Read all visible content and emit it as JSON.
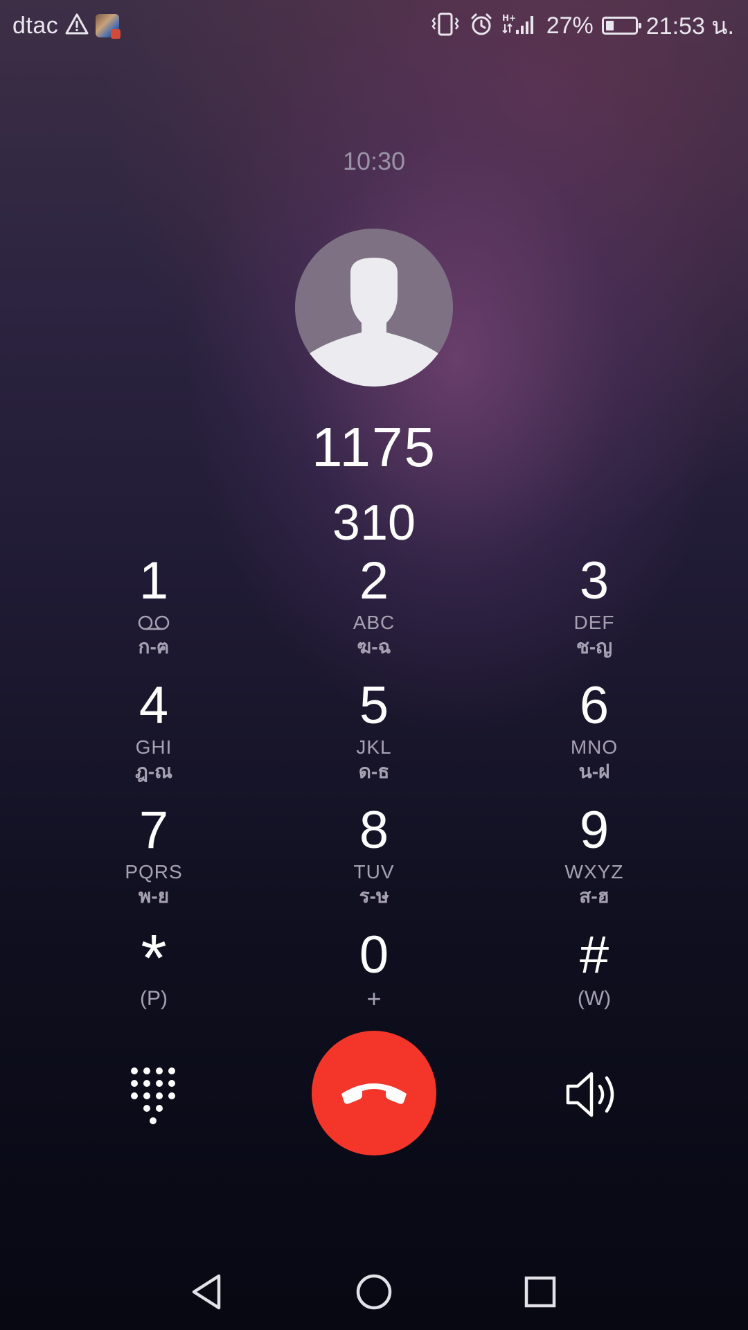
{
  "status_bar": {
    "carrier": "dtac",
    "battery_percent": "27%",
    "battery_level": 0.27,
    "time": "21:53 น.",
    "icons": [
      "warning-icon",
      "app-notification-icon",
      "vibrate-icon",
      "alarm-icon",
      "hplus-icon",
      "signal-icon",
      "battery-icon"
    ]
  },
  "call": {
    "duration": "10:30",
    "number": "1175",
    "dtmf_digits": "310"
  },
  "keypad": {
    "keys": [
      {
        "digit": "1",
        "letters": "",
        "thai": "ก-ฅ",
        "icon": "voicemail-icon"
      },
      {
        "digit": "2",
        "letters": "ABC",
        "thai": "ฆ-ฉ"
      },
      {
        "digit": "3",
        "letters": "DEF",
        "thai": "ช-ญ"
      },
      {
        "digit": "4",
        "letters": "GHI",
        "thai": "ฎ-ณ"
      },
      {
        "digit": "5",
        "letters": "JKL",
        "thai": "ด-ธ"
      },
      {
        "digit": "6",
        "letters": "MNO",
        "thai": "น-ฝ"
      },
      {
        "digit": "7",
        "letters": "PQRS",
        "thai": "พ-ย"
      },
      {
        "digit": "8",
        "letters": "TUV",
        "thai": "ร-ษ"
      },
      {
        "digit": "9",
        "letters": "WXYZ",
        "thai": "ส-ฮ"
      },
      {
        "digit": "*",
        "sub": "(P)"
      },
      {
        "digit": "0",
        "sub": "+"
      },
      {
        "digit": "#",
        "sub": "(W)"
      }
    ]
  },
  "controls": {
    "end_call_color": "#f4362a",
    "icons": [
      "dialpad-icon",
      "end-call-icon",
      "speaker-icon"
    ]
  },
  "nav": {
    "icons": [
      "back-icon",
      "home-icon",
      "recents-icon"
    ]
  }
}
